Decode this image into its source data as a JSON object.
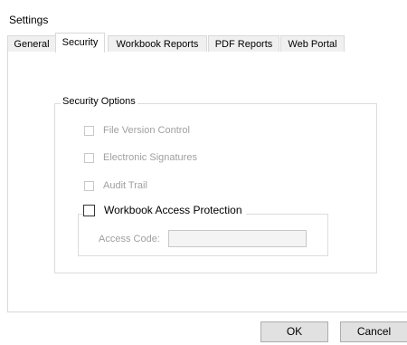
{
  "window": {
    "title": "Settings"
  },
  "tabs": [
    {
      "label": "General"
    },
    {
      "label": "Security"
    },
    {
      "label": "Workbook Reports"
    },
    {
      "label": "PDF Reports"
    },
    {
      "label": "Web Portal"
    }
  ],
  "active_tab": "Security",
  "security": {
    "group_label": "Security Options",
    "options": [
      {
        "label": "File Version Control",
        "checked": false,
        "enabled": false
      },
      {
        "label": "Electronic Signatures",
        "checked": false,
        "enabled": false
      },
      {
        "label": "Audit Trail",
        "checked": false,
        "enabled": false
      },
      {
        "label": "Workbook Access Protection",
        "checked": false,
        "enabled": true
      }
    ],
    "access_code_label": "Access Code:",
    "access_code_value": ""
  },
  "buttons": {
    "ok": "OK",
    "cancel": "Cancel"
  }
}
